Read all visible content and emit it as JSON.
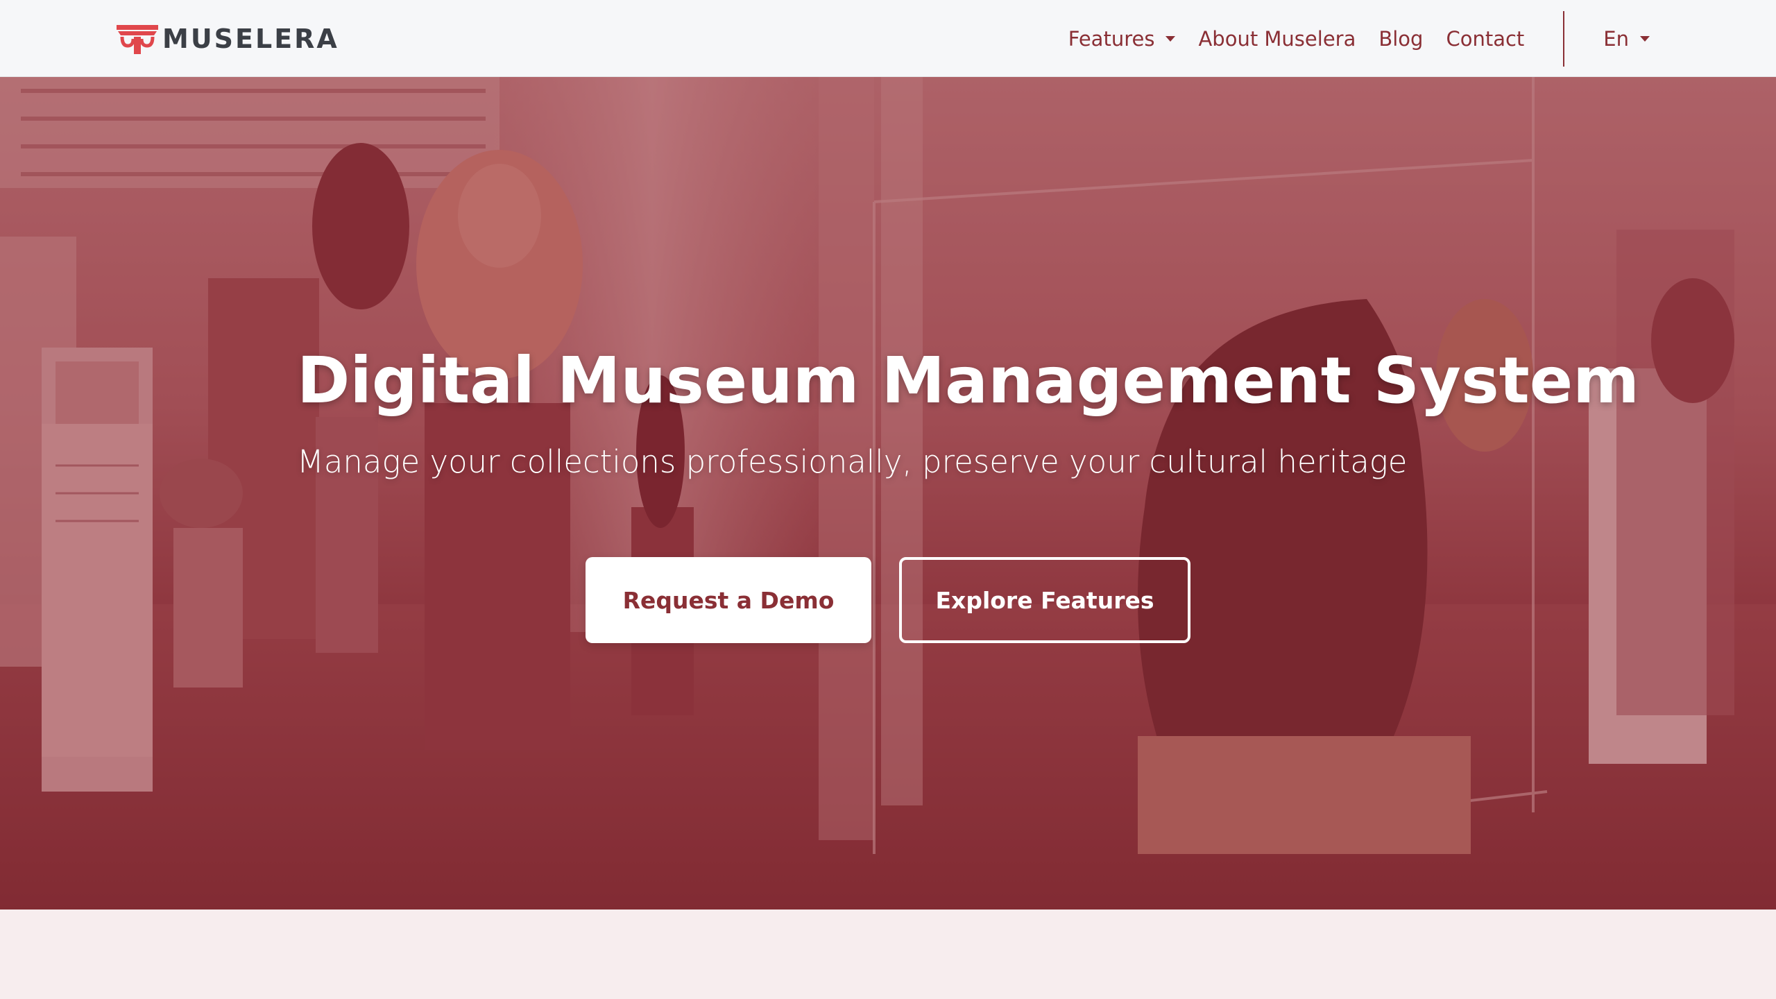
{
  "brand": {
    "name": "MUSELERA",
    "logo_icon": "column-capital-logo-icon",
    "colors": {
      "logo_red": "#e0474c",
      "wordmark": "#3b3f46"
    }
  },
  "nav": {
    "items": [
      {
        "label": "Features",
        "has_dropdown": true
      },
      {
        "label": "About Muselera",
        "has_dropdown": false
      },
      {
        "label": "Blog",
        "has_dropdown": false
      },
      {
        "label": "Contact",
        "has_dropdown": false
      }
    ],
    "language": {
      "label": "En",
      "has_dropdown": true
    },
    "link_color": "#8a2f35"
  },
  "hero": {
    "title": "Digital Museum Management System",
    "subtitle": "Manage your collections professionally, preserve your cultural heritage",
    "primary_button": "Request a Demo",
    "secondary_button": "Explore Features",
    "background": "museum-gallery-photo",
    "overlay_color": "#8c2630"
  },
  "colors": {
    "accent": "#8a2f35",
    "page_background": "#f7edee",
    "navbar_background": "#f6f7f9"
  }
}
